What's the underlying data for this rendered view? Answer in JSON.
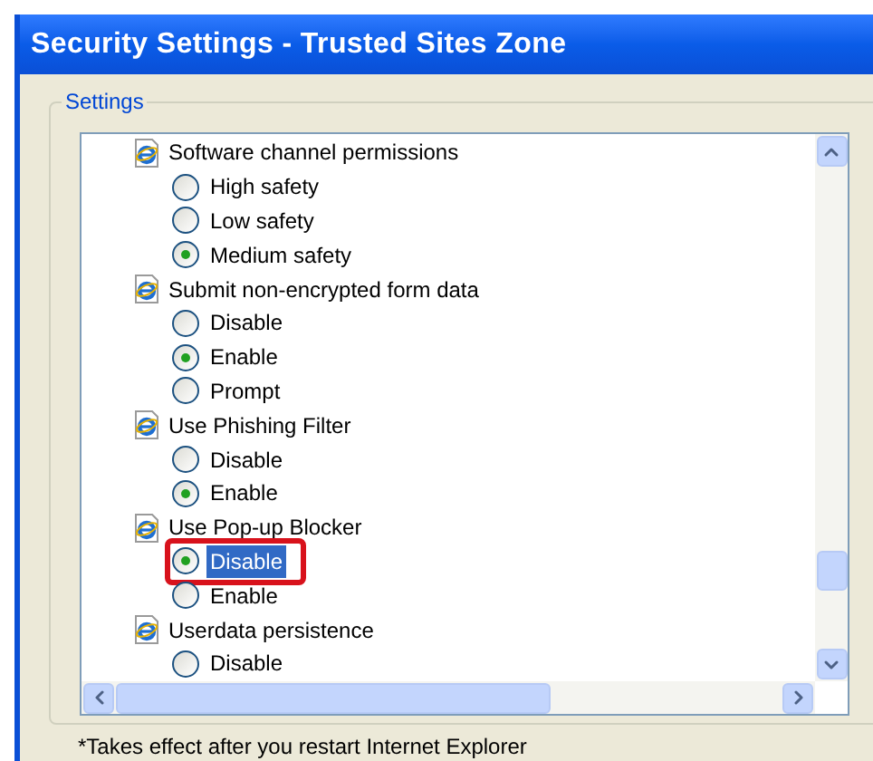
{
  "window": {
    "title": "Security Settings - Trusted Sites Zone"
  },
  "group": {
    "label": "Settings"
  },
  "settings": [
    {
      "label": "Software channel permissions",
      "options": [
        {
          "label": "High safety",
          "selected": false,
          "highlighted": false
        },
        {
          "label": "Low safety",
          "selected": false,
          "highlighted": false
        },
        {
          "label": "Medium safety",
          "selected": true,
          "highlighted": false
        }
      ]
    },
    {
      "label": "Submit non-encrypted form data",
      "options": [
        {
          "label": "Disable",
          "selected": false,
          "highlighted": false
        },
        {
          "label": "Enable",
          "selected": true,
          "highlighted": false
        },
        {
          "label": "Prompt",
          "selected": false,
          "highlighted": false
        }
      ]
    },
    {
      "label": "Use Phishing Filter",
      "options": [
        {
          "label": "Disable",
          "selected": false,
          "highlighted": false
        },
        {
          "label": "Enable",
          "selected": true,
          "highlighted": false
        }
      ]
    },
    {
      "label": "Use Pop-up Blocker",
      "options": [
        {
          "label": "Disable",
          "selected": true,
          "highlighted": true
        },
        {
          "label": "Enable",
          "selected": false,
          "highlighted": false
        }
      ]
    },
    {
      "label": "Userdata persistence",
      "options": [
        {
          "label": "Disable",
          "selected": false,
          "highlighted": false
        }
      ]
    }
  ],
  "footnote": "*Takes effect after you restart Internet Explorer"
}
